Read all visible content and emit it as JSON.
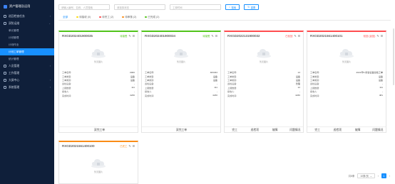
{
  "sidebar": {
    "title": "资产管理及运用",
    "items": [
      {
        "label": "巡回检查任务"
      },
      {
        "label": "双防运维",
        "expanded": true
      },
      {
        "label": "人员管理"
      },
      {
        "label": "工作管理"
      },
      {
        "label": "大屏中心"
      },
      {
        "label": "系统管理"
      }
    ],
    "sub_items": [
      {
        "label": "单元管理"
      },
      {
        "label": "计划管理"
      },
      {
        "label": "计划作业"
      },
      {
        "label": "计划工单管理",
        "active": true
      },
      {
        "label": "统计管理"
      }
    ]
  },
  "toolbar": {
    "search_placeholder": "请输入编号、名称、人员搜索",
    "status_placeholder": "请选择状态",
    "date_placeholder": "工单时间",
    "search_label": "搜索",
    "reset_label": "重置"
  },
  "tabs": [
    {
      "label": "全部",
      "active": true,
      "color": ""
    },
    {
      "label": "待接收 (0)",
      "color": "#fadb14"
    },
    {
      "label": "待完工 (2)",
      "color": "#ff4d4f"
    },
    {
      "label": "待审核 (2)",
      "color": "#fa8c16"
    },
    {
      "label": "已完成 (2)",
      "color": "#52c41a"
    }
  ],
  "field_labels": [
    "工单名称:",
    "工单类型:",
    "工单类别:",
    "巡检设备:",
    "上报数量:",
    "接收人:",
    "完成时间:"
  ],
  "no_image_text": "暂无图片",
  "cards": [
    {
      "id": "RXGD202401900035",
      "status": "待接受",
      "status_color": "#52c41a",
      "top": "#52c41a",
      "values": [
        "0000",
        "设备",
        "设备",
        "-",
        "111",
        "-",
        "4230"
      ],
      "foot": "双完工单"
    },
    {
      "id": "RXGD202401900034",
      "status": "待接受",
      "status_color": "#52c41a",
      "top": "#52c41a",
      "values": [
        "383333",
        "设备",
        "设备",
        "-",
        "111",
        "-",
        "4230"
      ],
      "foot": "双完工单"
    },
    {
      "id": "RXGD2022131900032",
      "status": "已驳回",
      "status_color": "#ff4d4f",
      "top": "#ff4d4f",
      "values": [
        "13",
        "设备",
        "设备",
        "管理",
        "12",
        "-",
        "4230"
      ],
      "foot": ""
    },
    {
      "id": "RXGD2021561400101",
      "status": "驳回 (返回)",
      "status_color": "#ff4d4f",
      "top": "#ff4d4f",
      "values": [
        "2021年5-综合设备巡检工单",
        "设备",
        "设备",
        "-",
        "111",
        "-",
        "481"
      ],
      "foot": ""
    },
    {
      "id": "RXGD2021561400100",
      "status": "已完工",
      "status_color": "#fa8c16",
      "top": "#fa8c16",
      "values": [],
      "foot": ""
    }
  ],
  "bottom_bar_a": [
    "双完工单",
    "双完工单"
  ],
  "bottom_bar_b": [
    "完工",
    "巡检项",
    "故障",
    "问题情况"
  ],
  "pager": {
    "total": "共5条",
    "page_size": "10条/页",
    "current": "1",
    "prev": "‹",
    "next": "›"
  }
}
